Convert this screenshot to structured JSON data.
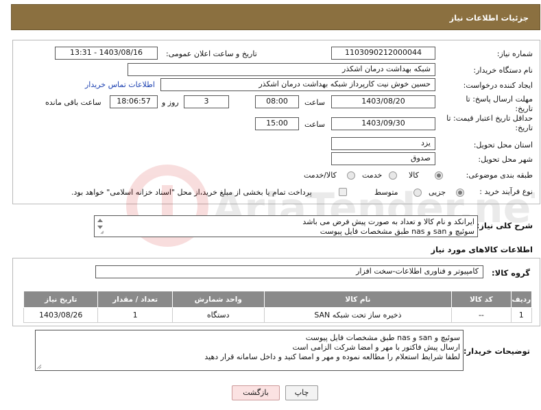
{
  "header": {
    "title": "جزئیات اطلاعات نیاز"
  },
  "form": {
    "need_number_label": "شماره نیاز:",
    "need_number": "1103090212000044",
    "announce_label": "تاریخ و ساعت اعلان عمومی:",
    "announce_value": "1403/08/16 - 13:31",
    "buyer_org_label": "نام دستگاه خریدار:",
    "buyer_org": "شبکه بهداشت درمان اشکذر",
    "requester_label": "ایجاد کننده درخواست:",
    "requester": "حسین خوش نیت کارپرداز شبکه بهداشت درمان اشکذر",
    "contact_link": "اطلاعات تماس خریدار",
    "reply_deadline_label": "مهلت ارسال پاسخ: تا تاریخ:",
    "reply_date": "1403/08/20",
    "time_label": "ساعت",
    "reply_time": "08:00",
    "days_value": "3",
    "days_and_label": "روز و",
    "remaining_time": "18:06:57",
    "remaining_label": "ساعت باقی مانده",
    "price_validity_label": "حداقل تاریخ اعتبار قیمت: تا تاریخ:",
    "validity_date": "1403/09/30",
    "validity_time": "15:00",
    "province_label": "استان محل تحویل:",
    "province": "یزد",
    "city_label": "شهر محل تحویل:",
    "city": "صدوق",
    "category_label": "طبقه بندی موضوعی:",
    "category_options": [
      "کالا",
      "خدمت",
      "کالا/خدمت"
    ],
    "process_label": "نوع فرآیند خرید :",
    "process_options": [
      "جزیی",
      "متوسط"
    ],
    "payment_note": "پرداخت تمام یا بخشی از مبلغ خرید،از محل \"اسناد خزانه اسلامی\" خواهد بود."
  },
  "description": {
    "label": "شرح کلی نیاز:",
    "line1": "ایرانکد و نام کالا و تعداد به صورت پیش فرض می باشد",
    "line2": "سوئیچ و san و nas طبق مشخصات فایل پیوست"
  },
  "goods": {
    "section_title": "اطلاعات کالاهای مورد نیاز",
    "group_label": "گروه کالا:",
    "group_value": "کامپیوتر و فناوری اطلاعات-سخت افزار",
    "columns": [
      "ردیف",
      "کد کالا",
      "نام کالا",
      "واحد شمارش",
      "تعداد / مقدار",
      "تاریخ نیاز"
    ],
    "rows": [
      {
        "index": "1",
        "code": "--",
        "name": "ذخیره ساز تحت شبکه SAN",
        "unit": "دستگاه",
        "qty": "1",
        "date": "1403/08/26"
      }
    ]
  },
  "buyer_notes": {
    "label": "توضیحات خریدار:",
    "line1": "سوئیچ و san و nas طبق مشخصات فایل پیوست",
    "line2": "ارسال پیش فاکتور با مهر و امضا شرکت الزامی است",
    "line3": "لطفا شرایط استعلام را مطالعه نموده و مهر و امضا کنید و داخل سامانه قرار دهید"
  },
  "buttons": {
    "print": "چاپ",
    "back": "بازگشت"
  },
  "watermark": {
    "text": "AriaTender.neT"
  }
}
